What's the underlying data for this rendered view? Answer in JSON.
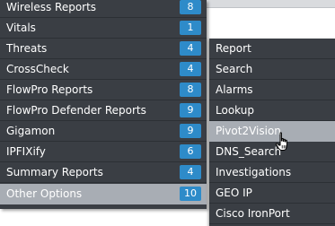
{
  "main_menu": {
    "items": [
      {
        "label": "Wireless Reports",
        "badge": "8"
      },
      {
        "label": "Vitals",
        "badge": "1"
      },
      {
        "label": "Threats",
        "badge": "4"
      },
      {
        "label": "CrossCheck",
        "badge": "4"
      },
      {
        "label": "FlowPro Reports",
        "badge": "8"
      },
      {
        "label": "FlowPro Defender Reports",
        "badge": "9"
      },
      {
        "label": "Gigamon",
        "badge": "9"
      },
      {
        "label": "IPFIXify",
        "badge": "6"
      },
      {
        "label": "Summary Reports",
        "badge": "4"
      },
      {
        "label": "Other Options",
        "badge": "10"
      }
    ]
  },
  "submenu": {
    "items": [
      {
        "label": "Report"
      },
      {
        "label": "Search"
      },
      {
        "label": "Alarms"
      },
      {
        "label": "Lookup"
      },
      {
        "label": "Pivot2Vision"
      },
      {
        "label": "DNS_Search"
      },
      {
        "label": "Investigations"
      },
      {
        "label": "GEO IP"
      },
      {
        "label": "Cisco IronPort"
      }
    ]
  },
  "colors": {
    "menu_bg": "#3a3e44",
    "highlight_bg": "#a8adb4",
    "badge_bg": "#2e8bc9",
    "text": "#ffffff"
  },
  "cursor": {
    "icon": "hand-pointer-icon"
  }
}
